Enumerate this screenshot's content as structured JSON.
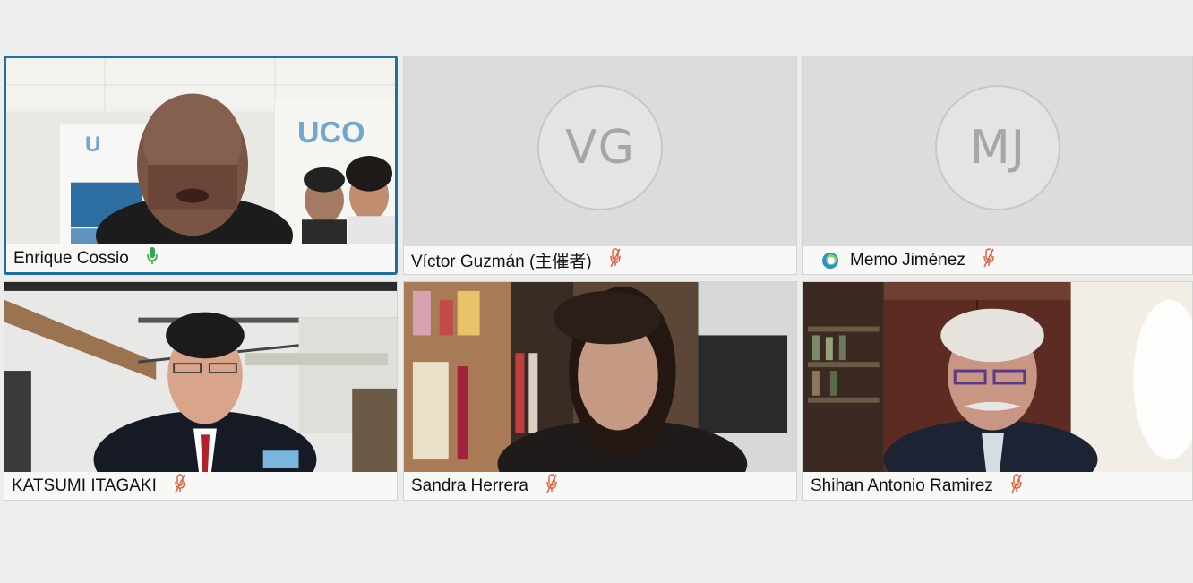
{
  "participants": [
    {
      "name": "Enrique Cossio",
      "initials": "",
      "muted": false,
      "active_speaker": true
    },
    {
      "name": "Víctor Guzmán (主催者)",
      "initials": "VG",
      "muted": true,
      "active_speaker": false
    },
    {
      "name": "Memo Jiménez",
      "initials": "MJ",
      "muted": true,
      "active_speaker": false
    },
    {
      "name": "KATSUMI ITAGAKI",
      "initials": "",
      "muted": true,
      "active_speaker": false
    },
    {
      "name": "Sandra Herrera",
      "initials": "",
      "muted": true,
      "active_speaker": false
    },
    {
      "name": "Shihan Antonio Ramirez",
      "initials": "",
      "muted": true,
      "active_speaker": false
    }
  ],
  "banner_text": "UCO",
  "colors": {
    "active_border": "#1f6fa3",
    "mic_on": "#2fa84f",
    "mic_muted": "#e05a3a",
    "background": "#ededeb"
  }
}
